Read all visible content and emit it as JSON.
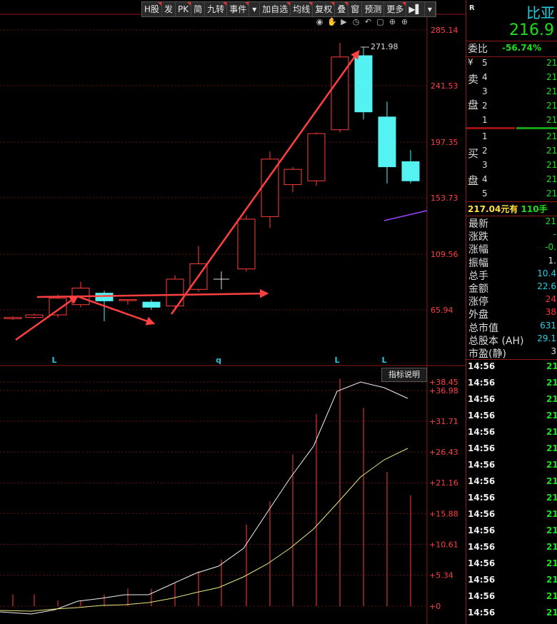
{
  "toolbar": {
    "items": [
      "H股",
      "发",
      "PK",
      "简",
      "九转",
      "事件",
      "▾",
      "加自选",
      "均线",
      "复权",
      "叠",
      "窗",
      "预测",
      "更多",
      "▶▌",
      "▾"
    ],
    "red_marked": [
      0,
      2,
      4,
      5,
      7,
      8,
      9,
      10,
      13
    ]
  },
  "tool_icons": [
    "eye-icon",
    "hand-icon",
    "play-icon",
    "clock-icon",
    "undo-icon",
    "lock-icon",
    "plus-icon",
    "plus-circle-icon"
  ],
  "main_chart": {
    "price_ticks": [
      "285.14",
      "241.53",
      "197.35",
      "153.73",
      "109.56",
      "65.94"
    ],
    "peak_label": "271.98",
    "x_markers": [
      "L",
      "q",
      "L",
      "L"
    ],
    "candles": [
      {
        "o": 59,
        "c": 60,
        "h": 61,
        "l": 58,
        "color": "red"
      },
      {
        "o": 60,
        "c": 62,
        "h": 63,
        "l": 59,
        "color": "red"
      },
      {
        "o": 62,
        "c": 75,
        "h": 78,
        "l": 60,
        "color": "red"
      },
      {
        "o": 70,
        "c": 83,
        "h": 88,
        "l": 68,
        "color": "red"
      },
      {
        "o": 79,
        "c": 73,
        "h": 81,
        "l": 57,
        "color": "cyan"
      },
      {
        "o": 74,
        "c": 74,
        "h": 74,
        "l": 70,
        "color": "red"
      },
      {
        "o": 72,
        "c": 68,
        "h": 74,
        "l": 66,
        "color": "cyan"
      },
      {
        "o": 69,
        "c": 90,
        "h": 93,
        "l": 67,
        "color": "red"
      },
      {
        "o": 82,
        "c": 102,
        "h": 116,
        "l": 80,
        "color": "red"
      },
      {
        "o": 90,
        "c": 90,
        "h": 96,
        "l": 82,
        "color": "white"
      },
      {
        "o": 98,
        "c": 137,
        "h": 140,
        "l": 96,
        "color": "red"
      },
      {
        "o": 139,
        "c": 184,
        "h": 190,
        "l": 130,
        "color": "red"
      },
      {
        "o": 176,
        "c": 164,
        "h": 178,
        "l": 158,
        "color": "red"
      },
      {
        "o": 167,
        "c": 204,
        "h": 205,
        "l": 163,
        "color": "red"
      },
      {
        "o": 207,
        "c": 264,
        "h": 275,
        "l": 205,
        "color": "red"
      },
      {
        "o": 265,
        "c": 221,
        "h": 272,
        "l": 215,
        "color": "cyan"
      },
      {
        "o": 217,
        "c": 178,
        "h": 229,
        "l": 165,
        "color": "cyan"
      },
      {
        "o": 182,
        "c": 167,
        "h": 191,
        "l": 165,
        "color": "cyan"
      }
    ]
  },
  "indicator": {
    "button_label": "指标说明",
    "ticks": [
      "+38.45",
      "+36.98",
      "+31.71",
      "+26.43",
      "+21.16",
      "+15.88",
      "+10.61",
      "+5.34",
      "+0"
    ]
  },
  "quote": {
    "r_label": "R",
    "name": "比亚",
    "price": "216.9",
    "weibi_label": "委比",
    "weibi_value": "-56.74%",
    "sell_label": [
      "¥",
      "卖",
      "盘"
    ],
    "buy_label": [
      "买",
      "盘"
    ],
    "sell_rows": [
      {
        "n": "5",
        "p": "21"
      },
      {
        "n": "4",
        "p": "21"
      },
      {
        "n": "3",
        "p": "21"
      },
      {
        "n": "2",
        "p": "21"
      },
      {
        "n": "1",
        "p": "21"
      }
    ],
    "buy_rows": [
      {
        "n": "1",
        "p": "21"
      },
      {
        "n": "2",
        "p": "21"
      },
      {
        "n": "3",
        "p": "21"
      },
      {
        "n": "4",
        "p": "21"
      },
      {
        "n": "5",
        "p": "21"
      }
    ],
    "summary_price": "217.04",
    "summary_mid": "元有",
    "summary_lots": "110手",
    "stats": [
      {
        "k": "最新",
        "v": "21",
        "color": "#19e019"
      },
      {
        "k": "涨跌",
        "v": "-",
        "color": "#19e019"
      },
      {
        "k": "涨幅",
        "v": "-0.",
        "color": "#19e019"
      },
      {
        "k": "振幅",
        "v": "1.",
        "color": "#dddddd"
      },
      {
        "k": "总手",
        "v": "10.4",
        "color": "#20d0e0"
      },
      {
        "k": "金额",
        "v": "22.6",
        "color": "#20d0e0"
      },
      {
        "k": "涨停",
        "v": "24",
        "color": "#ff3030"
      },
      {
        "k": "外盘",
        "v": "38",
        "color": "#ff3030"
      },
      {
        "k": "总市值",
        "v": "631",
        "color": "#20d0e0"
      },
      {
        "k": "总股本 (AH)",
        "v": "29.1",
        "color": "#20d0e0"
      },
      {
        "k": "市盈(静)",
        "v": "3",
        "color": "#dddddd"
      }
    ],
    "ticks": [
      {
        "t": "14:56",
        "p": "21"
      },
      {
        "t": "14:56",
        "p": "21"
      },
      {
        "t": "14:56",
        "p": "21"
      },
      {
        "t": "14:56",
        "p": "21"
      },
      {
        "t": "14:56",
        "p": "21"
      },
      {
        "t": "14:56",
        "p": "21"
      },
      {
        "t": "14:56",
        "p": "21"
      },
      {
        "t": "14:56",
        "p": "21"
      },
      {
        "t": "14:56",
        "p": "21"
      },
      {
        "t": "14:56",
        "p": "21"
      },
      {
        "t": "14:56",
        "p": "21"
      },
      {
        "t": "14:56",
        "p": "21"
      },
      {
        "t": "14:56",
        "p": "21"
      },
      {
        "t": "14:56",
        "p": "21"
      },
      {
        "t": "14:56",
        "p": "21"
      },
      {
        "t": "14:56",
        "p": "21"
      }
    ]
  }
}
